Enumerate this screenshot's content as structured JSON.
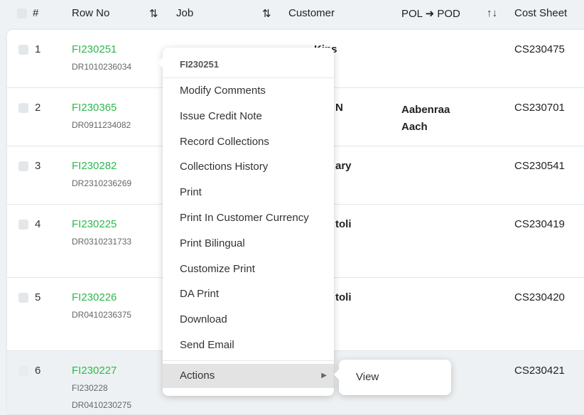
{
  "header": {
    "select_all": "",
    "num": "#",
    "row_no": "Row No",
    "job": "Job",
    "customer": "Customer",
    "pol_pod": "POL ➜ POD",
    "cost_sheet": "Cost Sheet",
    "sort_icon": "⇅",
    "sort_active_icon": "↑↓"
  },
  "rows": [
    {
      "num": "1",
      "row_no": "FI230251",
      "subs": [
        "DR1010236034"
      ],
      "customer_fragment": "Kins",
      "pol_pod": "",
      "cost_sheet": "CS230475"
    },
    {
      "num": "2",
      "row_no": "FI230365",
      "subs": [
        "DR0911234082"
      ],
      "customer_fragment": "N",
      "pol_pod": "Aabenraa",
      "pol_pod2": "Aach",
      "cost_sheet": "CS230701"
    },
    {
      "num": "3",
      "row_no": "FI230282",
      "subs": [
        "DR2310236269"
      ],
      "customer_fragment": "ary",
      "pol_pod": "",
      "cost_sheet": "CS230541"
    },
    {
      "num": "4",
      "row_no": "FI230225",
      "subs": [
        "DR0310231733"
      ],
      "customer_fragment": "toli",
      "pol_pod": "",
      "cost_sheet": "CS230419"
    },
    {
      "num": "5",
      "row_no": "FI230226",
      "subs": [
        "DR0410236375"
      ],
      "customer_fragment": "toli",
      "pol_pod": "",
      "cost_sheet": "CS230420"
    },
    {
      "num": "6",
      "row_no": "FI230227",
      "subs": [
        "FI230228",
        "DR0410230275"
      ],
      "customer_fragment": "",
      "pol_pod": "",
      "cost_sheet": "CS230421"
    }
  ],
  "context_menu": {
    "title": "FI230251",
    "items": [
      "Modify Comments",
      "Issue Credit Note",
      "Record Collections",
      "Collections History",
      "Print",
      "Print In Customer Currency",
      "Print Bilingual",
      "Customize Print",
      "DA Print",
      "Download",
      "Send Email"
    ],
    "actions": "Actions",
    "actions_arrow": "▶"
  },
  "submenu": {
    "items": [
      "View"
    ]
  }
}
